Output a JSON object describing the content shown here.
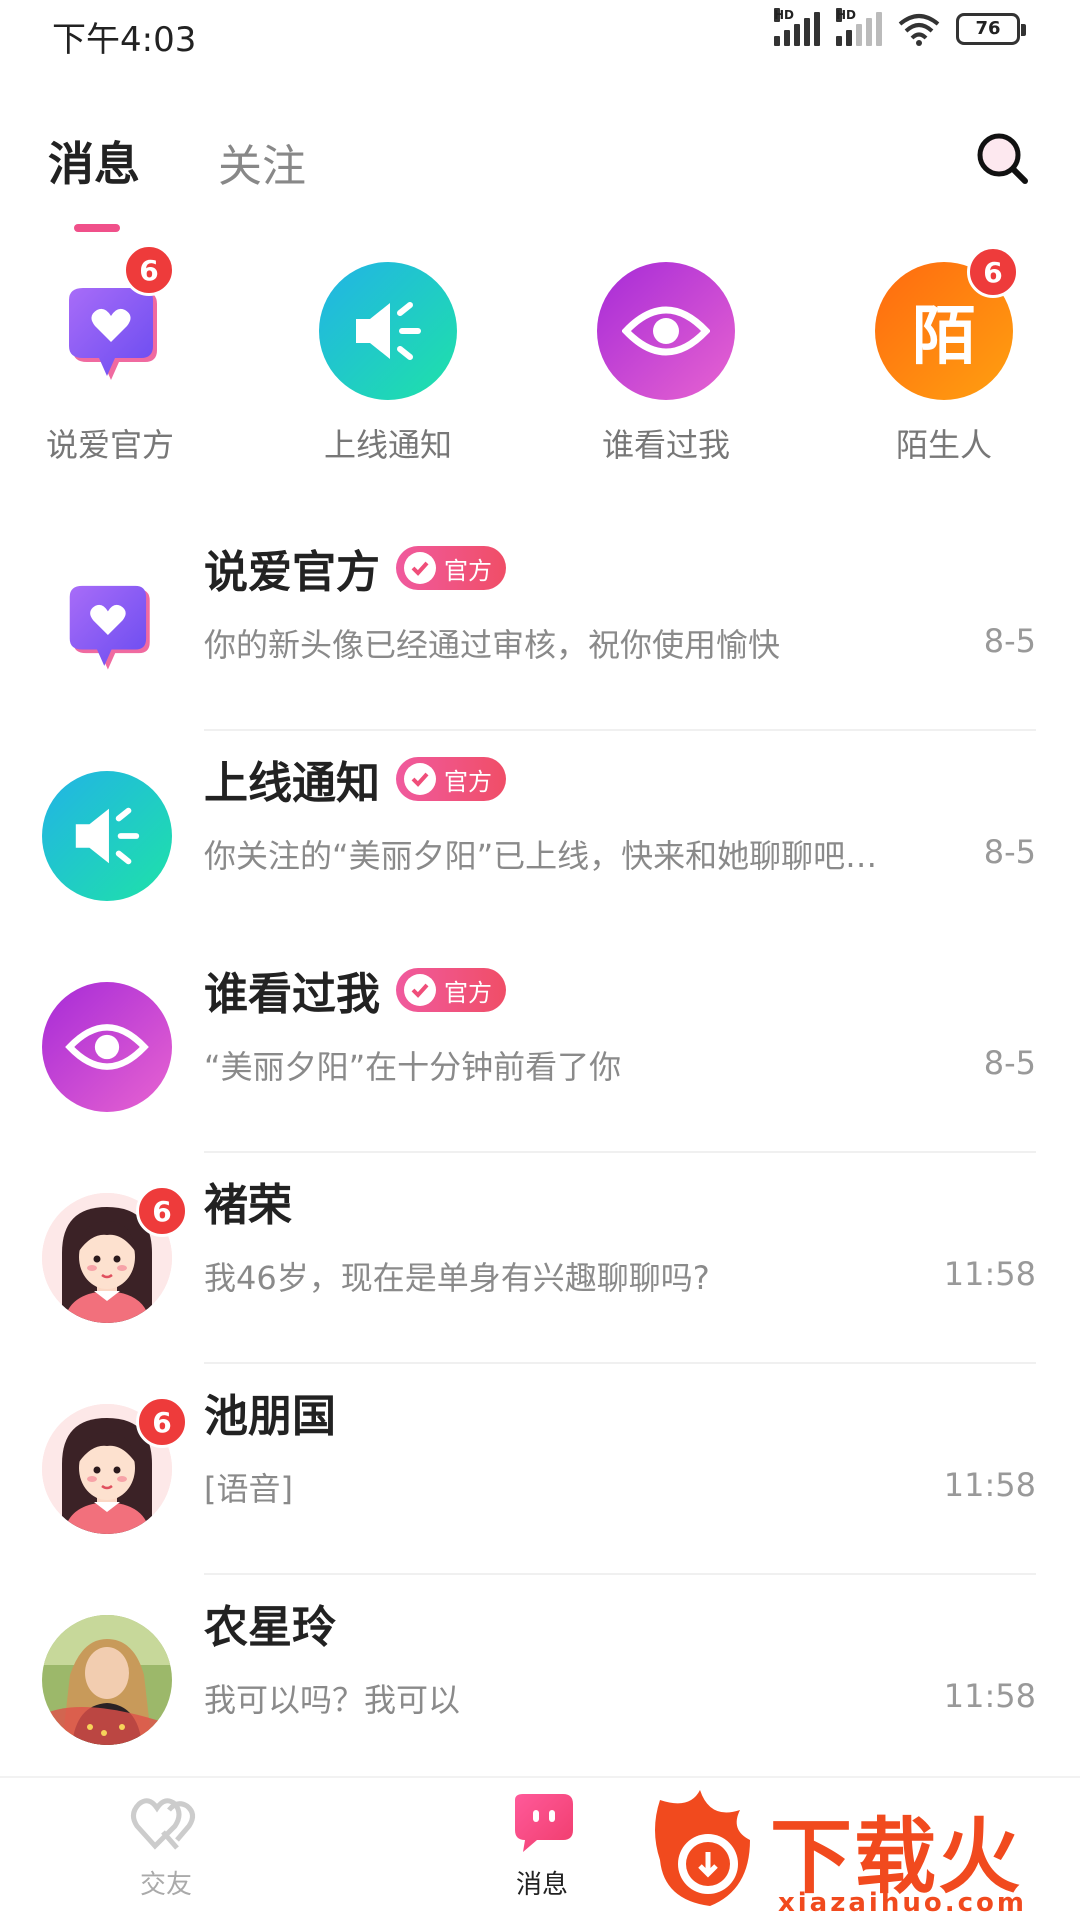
{
  "status_bar": {
    "time": "下午4:03",
    "hd1": "HD",
    "hd2": "HD",
    "battery": "76"
  },
  "tabs": [
    {
      "label": "消息",
      "active": true
    },
    {
      "label": "关注",
      "active": false
    }
  ],
  "shortcuts": [
    {
      "label": "说爱官方",
      "badge": "6",
      "icon": "heart-bubble-icon",
      "color": "#9b5cf4"
    },
    {
      "label": "上线通知",
      "badge": "",
      "icon": "speaker-icon",
      "color": "#1fc6c6"
    },
    {
      "label": "谁看过我",
      "badge": "",
      "icon": "eye-icon",
      "color": "#c43fd8"
    },
    {
      "label": "陌生人",
      "badge": "6",
      "icon": "stranger-icon",
      "glyph": "陌",
      "color": "#ff8c0a"
    }
  ],
  "official_tag": "官方",
  "conversations": [
    {
      "name": "说爱官方",
      "official": true,
      "message": "你的新头像已经通过审核，祝你使用愉快",
      "time": "8-5",
      "badge": ""
    },
    {
      "name": "上线通知",
      "official": true,
      "message": "你关注的“美丽夕阳”已上线，快来和她聊聊吧…",
      "time": "8-5",
      "badge": ""
    },
    {
      "name": "谁看过我",
      "official": true,
      "message": "“美丽夕阳”在十分钟前看了你",
      "time": "8-5",
      "badge": ""
    },
    {
      "name": "褚荣",
      "official": false,
      "message": "我46岁，现在是单身有兴趣聊聊吗?",
      "time": "11:58",
      "badge": "6"
    },
    {
      "name": "池朋国",
      "official": false,
      "message": "[语音]",
      "time": "11:58",
      "badge": "6"
    },
    {
      "name": "农星玲",
      "official": false,
      "message": "我可以吗？我可以",
      "time": "11:58",
      "badge": ""
    }
  ],
  "bottom_nav": [
    {
      "label": "交友",
      "icon": "hearts-outline-icon",
      "active": false
    },
    {
      "label": "消息",
      "icon": "chat-bubble-icon",
      "active": true
    }
  ],
  "watermark": {
    "text": "下载火",
    "url": "xiazaihuo.com"
  }
}
